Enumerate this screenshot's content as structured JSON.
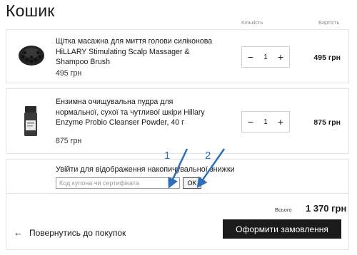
{
  "page": {
    "title": "Кошик",
    "col_quantity": "Кількість",
    "col_price": "Вартість"
  },
  "items": [
    {
      "name": "Щітка масажна для миття голови силіконова HiLLARY Stimulating Scalp Massager & Shampoo Brush",
      "unit_price": "495 грн",
      "quantity": "1",
      "total": "495 грн",
      "image": "scalp-brush-image"
    },
    {
      "name": "Ензимна очищувальна пудра для нормальної, сухої та чутливої шкіри Hillary Enzyme Probio Cleanser Powder, 40 г",
      "unit_price": "875 грн",
      "quantity": "1",
      "total": "875 грн",
      "image": "cleanser-bottle-image"
    }
  ],
  "stepper": {
    "minus": "−",
    "plus": "+"
  },
  "coupon": {
    "hint": "Увійти для відображення накопичувальної знижки",
    "placeholder": "Код купона чи сертифіката",
    "clear_glyph": "×",
    "ok_label": "OK"
  },
  "annotations": {
    "marker_1": "1",
    "marker_2": "2",
    "color": "#2e6fb8"
  },
  "summary": {
    "total_label": "Всього",
    "total_value": "1 370 грн",
    "back_label": "Повернутись до покупок",
    "back_arrow": "←",
    "checkout_label": "Оформити замовлення"
  }
}
